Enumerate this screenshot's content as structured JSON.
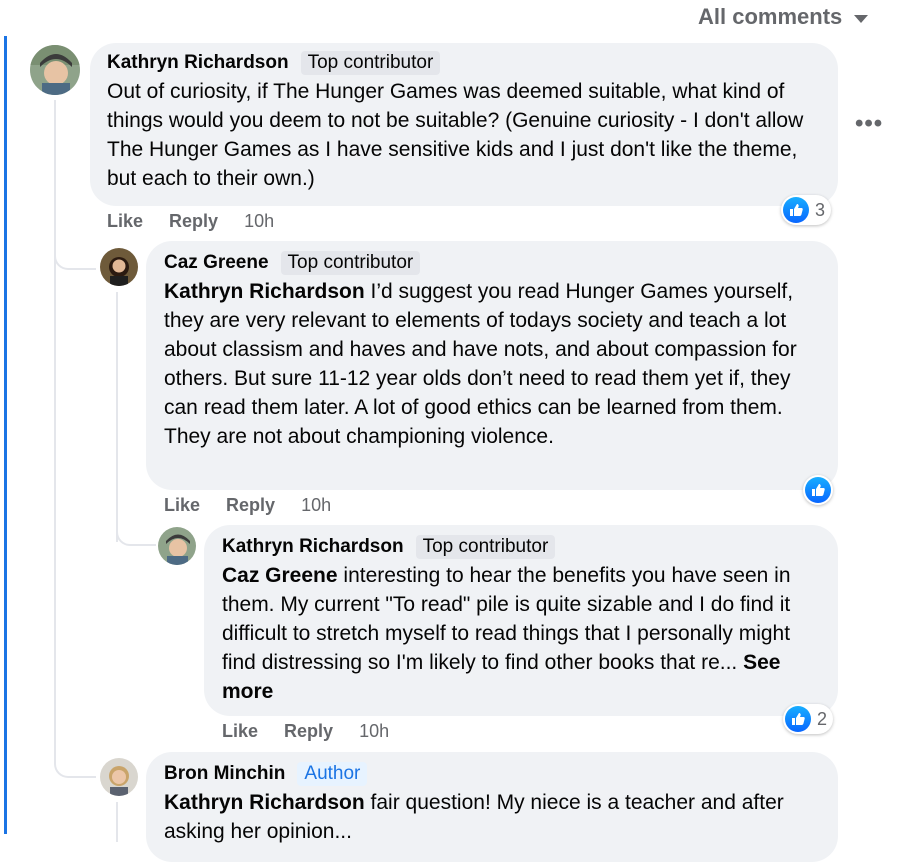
{
  "header": {
    "filter_label": "All comments"
  },
  "comments": [
    {
      "name": "Kathryn Richardson",
      "badge": "Top contributor",
      "text": "Out of curiosity, if The Hunger Games was deemed suitable, what kind of things would you deem to not be suitable? (Genuine curiosity - I don't allow The Hunger Games as I have sensitive kids and I just don't like the theme, but each to their own.)",
      "like": "Like",
      "reply": "Reply",
      "time": "10h",
      "reaction_count": "3"
    },
    {
      "name": "Caz Greene",
      "badge": "Top contributor",
      "mention": "Kathryn Richardson",
      "text": " I’d suggest you read Hunger Games yourself, they are very relevant to elements of todays society and teach a lot about classism and haves and have nots, and about compassion for others. But sure 11-12 year olds don’t need to read them yet if, they can read them later. A lot of good ethics can be learned from them. They are not about championing violence.",
      "like": "Like",
      "reply": "Reply",
      "time": "10h"
    },
    {
      "name": "Kathryn Richardson",
      "badge": "Top contributor",
      "mention": "Caz Greene",
      "text": " interesting to hear the benefits you have seen in them. My current \"To read\" pile is quite sizable and I do find it difficult to stretch myself to read things that I personally might find distressing so I'm likely to find other books that re...",
      "see_more": "See more",
      "like": "Like",
      "reply": "Reply",
      "time": "10h",
      "reaction_count": "2"
    },
    {
      "name": "Bron Minchin",
      "badge": "Author",
      "mention": "Kathryn Richardson",
      "text": " fair question! My niece is a teacher and after asking her opinion..."
    }
  ],
  "colors": {
    "accent": "#1b74e4",
    "bubble": "#f0f2f5",
    "muted": "#65676b"
  },
  "icons": {
    "like": "thumbs-up-icon",
    "more": "more-options-icon",
    "dropdown": "caret-down-icon"
  }
}
